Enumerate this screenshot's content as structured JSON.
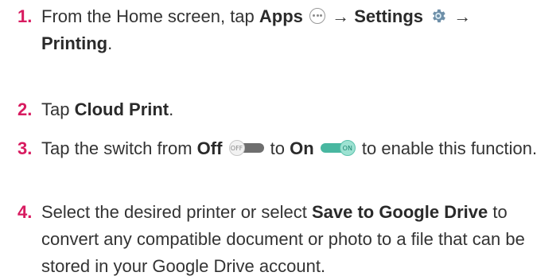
{
  "steps": [
    {
      "number": "1.",
      "text_before": "From the Home screen, tap ",
      "apps": "Apps",
      "arrow1": " → ",
      "settings": "Settings",
      "arrow2": " →",
      "printing": "Printing",
      "end": "."
    },
    {
      "number": "2.",
      "text_before": "Tap ",
      "cloud_print": "Cloud Print",
      "end": "."
    },
    {
      "number": "3.",
      "text_before": "Tap the switch from ",
      "off": "Off",
      "to": " to ",
      "on": "On",
      "text_after": " to enable this function."
    },
    {
      "number": "4.",
      "text_before": "Select the desired printer or select ",
      "save": "Save to Google Drive",
      "text_after": " to convert any compatible document or photo to a file that can be stored in your Google Drive account."
    }
  ],
  "toggle_off_label": "OFF",
  "toggle_on_label": "ON",
  "icons": {
    "apps": "apps-icon",
    "settings": "gear-icon",
    "off": "toggle-off-icon",
    "on": "toggle-on-icon"
  },
  "colors": {
    "step_number": "#d81b60",
    "text": "#333333",
    "toggle_on": "#48b7a0",
    "toggle_off": "#6e6e6e"
  }
}
